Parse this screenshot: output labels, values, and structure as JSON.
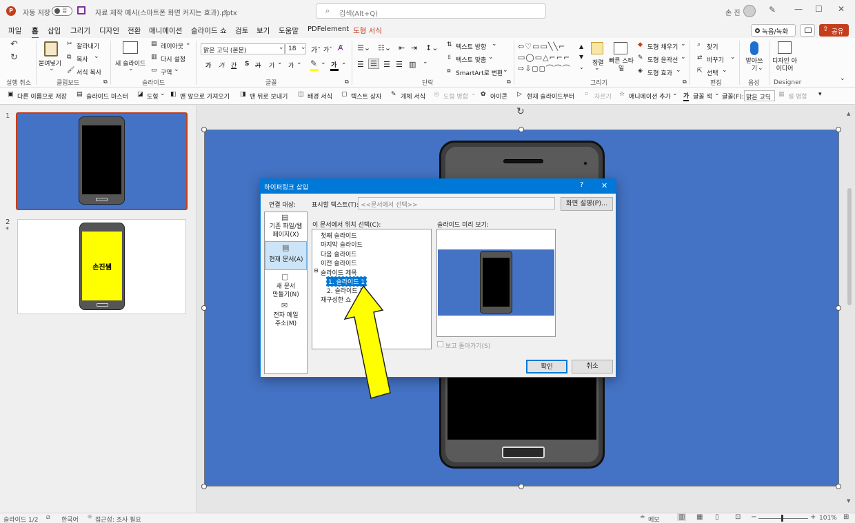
{
  "titlebar": {
    "autosave": "자동 저장",
    "autosave_state": "끔",
    "filename": "자료 제작 예시(스마트폰 화면 커지는 효과).pptx",
    "search_placeholder": "검색(Alt+Q)",
    "user": "손 진"
  },
  "menu": {
    "tabs": [
      "파일",
      "홈",
      "삽입",
      "그리기",
      "디자인",
      "전환",
      "애니메이션",
      "슬라이드 쇼",
      "검토",
      "보기",
      "도움말",
      "PDFelement",
      "도형 서식"
    ],
    "record": "녹음/녹화",
    "share": "공유"
  },
  "ribbon": {
    "undo_group": "실행 취소",
    "clipboard": {
      "group": "클립보드",
      "paste": "붙여넣기",
      "cut": "잘라내기",
      "copy": "복사",
      "format_painter": "서식 복사"
    },
    "slides": {
      "group": "슬라이드",
      "new": "새 슬라이드",
      "layout": "레이아웃",
      "reset": "다시 설정",
      "section": "구역"
    },
    "font": {
      "group": "글꼴",
      "name": "맑은 고딕 (본문)",
      "size": "18",
      "bold": "가",
      "italic": "가",
      "underline": "간",
      "shadow": "S",
      "strike": "가",
      "char_spacing": "가",
      "case": "가",
      "font_color": "가"
    },
    "paragraph": {
      "group": "단락",
      "text_direction": "텍스트 방향",
      "align_text": "텍스트 맞춤",
      "smartart": "SmartArt로 변환"
    },
    "drawing": {
      "group": "그리기",
      "arrange": "정렬",
      "quick_styles": "빠른 스타일",
      "shape_fill": "도형 채우기",
      "shape_outline": "도형 윤곽선",
      "shape_effects": "도형 효과"
    },
    "editing": {
      "group": "편집",
      "find": "찾기",
      "replace": "바꾸기",
      "select": "선택"
    },
    "voice": {
      "group": "음성",
      "dictate": "받아쓰기"
    },
    "designer": {
      "group": "Designer",
      "ideas": "디자인 아이디어"
    }
  },
  "qat": [
    "다른 이름으로 저장",
    "슬라이드 마스터",
    "도형",
    "맨 앞으로 가져오기",
    "맨 뒤로 보내기",
    "배경 서식",
    "텍스트 상자",
    "개체 서식",
    "도형 병합",
    "아이콘",
    "현재 슬라이드부터",
    "자르기",
    "애니메이션 추가",
    "글꼴 색",
    "글꼴(F):",
    "맑은 고딕",
    "셀 병합"
  ],
  "thumbnails": [
    {
      "num": "1",
      "text": ""
    },
    {
      "num": "2",
      "star": "*",
      "text": "손진쌤"
    }
  ],
  "dialog": {
    "title": "하이퍼링크 삽입",
    "help": "?",
    "close": "✕",
    "link_to": "연결 대상:",
    "nav": [
      {
        "label1": "기존 파일/웹",
        "label2": "페이지(X)"
      },
      {
        "label1": "현재 문서(A)",
        "label2": ""
      },
      {
        "label1": "새 문서",
        "label2": "만들기(N)"
      },
      {
        "label1": "전자 메일",
        "label2": "주소(M)"
      }
    ],
    "display_text_label": "표시할 텍스트(T):",
    "display_text_value": "<<문서에서 선택>>",
    "screentip": "화면 설명(P)...",
    "place_label": "이 문서에서 위치 선택(C):",
    "tree": [
      "첫째 슬라이드",
      "마지막 슬라이드",
      "다음 슬라이드",
      "이전 슬라이드",
      "슬라이드 제목",
      "1. 슬라이드 1",
      "2. 슬라이드 2",
      "재구성한 쇼"
    ],
    "preview_label": "슬라이드 미리 보기:",
    "show_return": "보고 돌아가기(S)",
    "ok": "확인",
    "cancel": "취소"
  },
  "status": {
    "slide": "슬라이드 1/2",
    "lang": "한국어",
    "access": "접근성: 조사 필요",
    "notes": "메모",
    "zoom": "101%"
  },
  "colors": {
    "slide_blue": "#4472c4",
    "accent_red": "#c43e1c",
    "select_blue": "#0078d7",
    "arrow_yellow": "#ffff00"
  }
}
